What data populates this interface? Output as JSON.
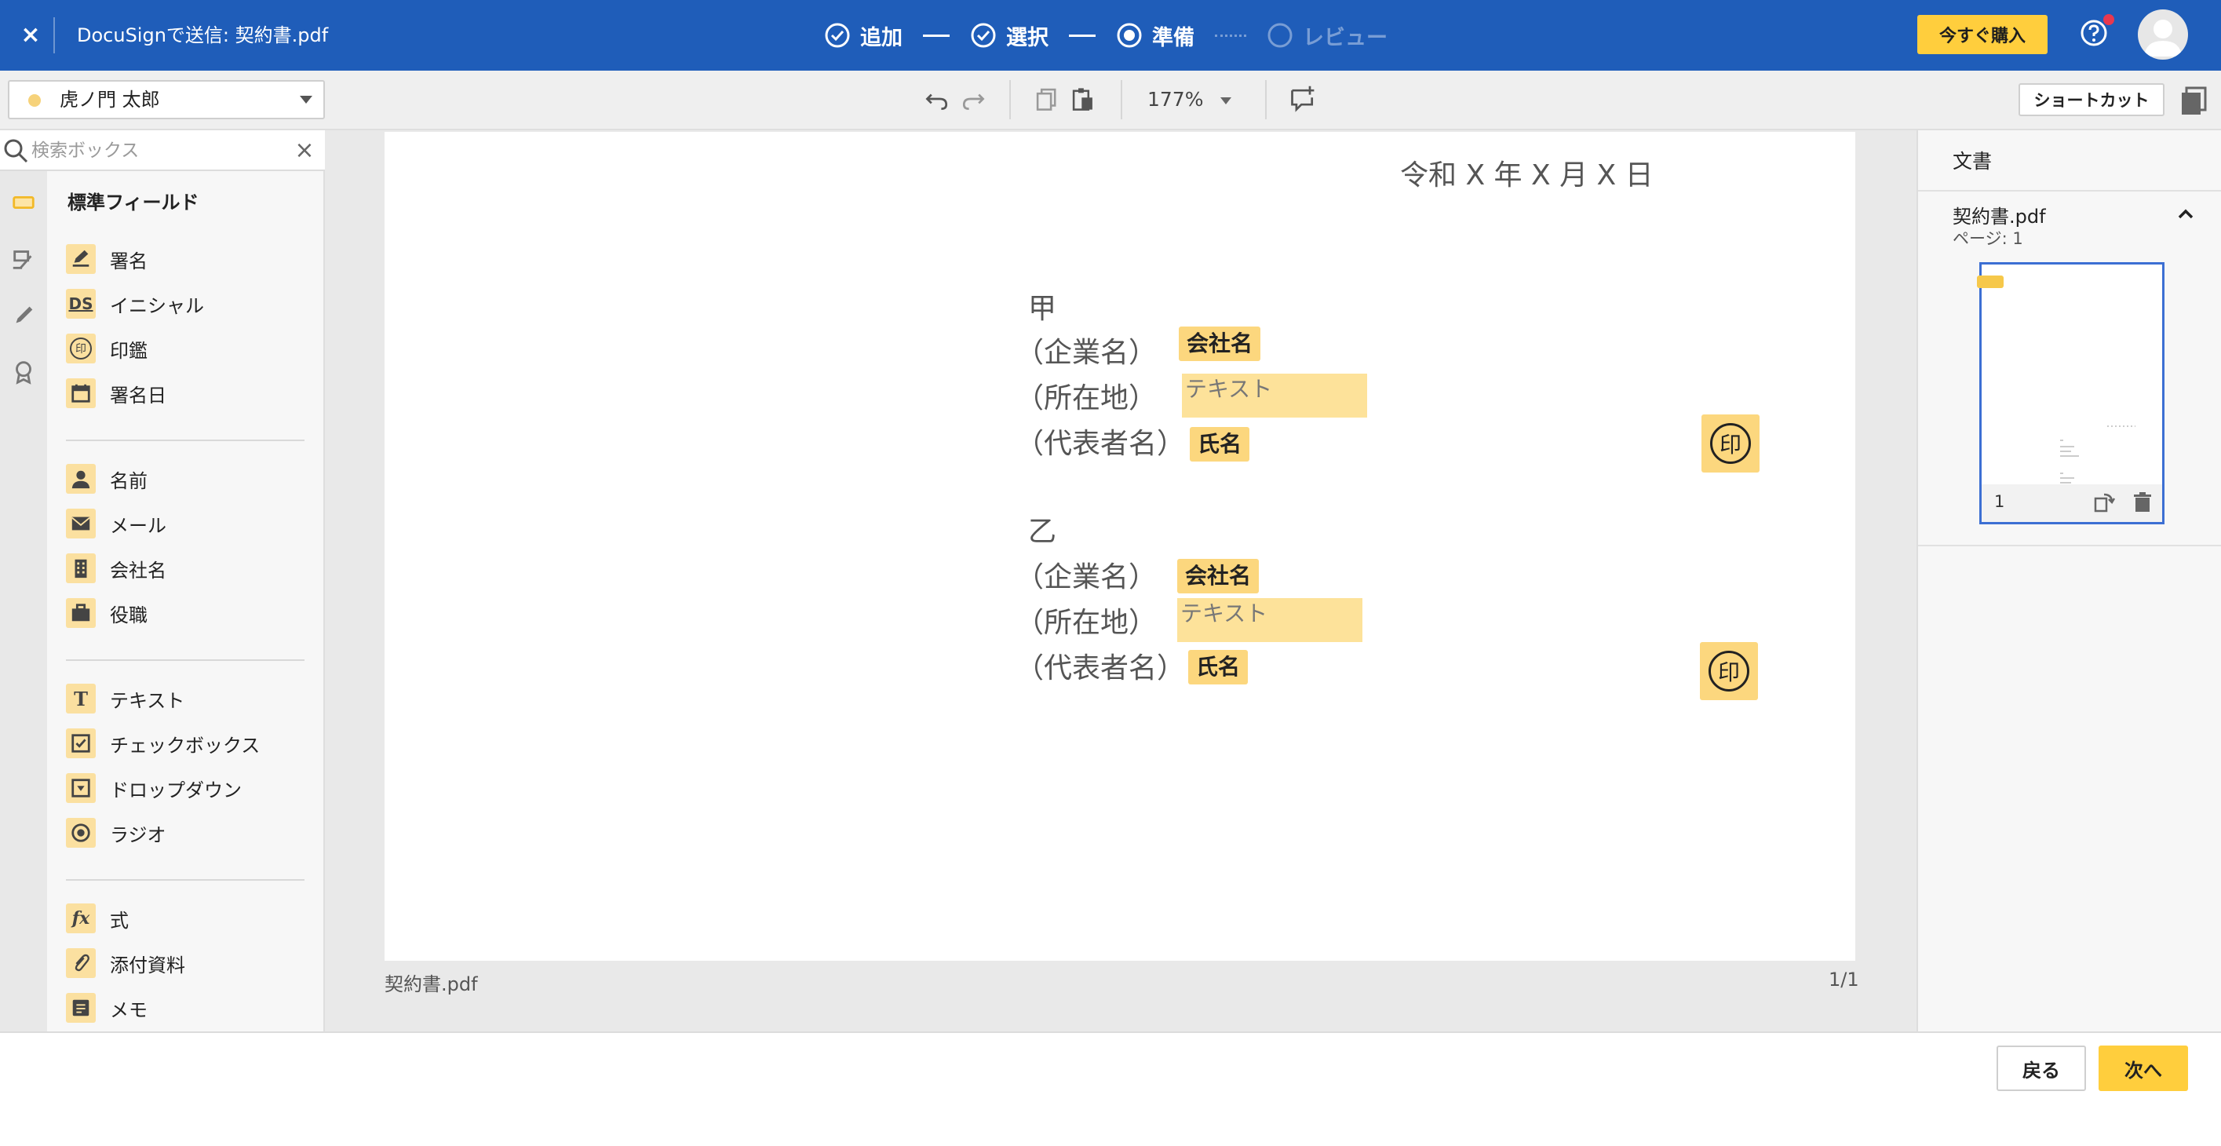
{
  "header": {
    "close_label": "×",
    "title": "DocuSignで送信: 契約書.pdf",
    "steps": [
      {
        "label": "追加",
        "state": "done"
      },
      {
        "label": "選択",
        "state": "done"
      },
      {
        "label": "準備",
        "state": "current"
      },
      {
        "label": "レビュー",
        "state": "pending"
      }
    ],
    "buy_label": "今すぐ購入"
  },
  "toolbar": {
    "recipient_name": "虎ノ門 太郎",
    "zoom": "177%",
    "shortcut_label": "ショートカット"
  },
  "search": {
    "placeholder": "検索ボックス",
    "clear_label": "×"
  },
  "fields_panel": {
    "title": "標準フィールド",
    "groups": [
      [
        {
          "label": "署名",
          "icon": "signature-icon"
        },
        {
          "label": "イニシャル",
          "icon": "initials-icon"
        },
        {
          "label": "印鑑",
          "icon": "seal-icon"
        },
        {
          "label": "署名日",
          "icon": "calendar-icon"
        }
      ],
      [
        {
          "label": "名前",
          "icon": "person-icon"
        },
        {
          "label": "メール",
          "icon": "envelope-icon"
        },
        {
          "label": "会社名",
          "icon": "building-icon"
        },
        {
          "label": "役職",
          "icon": "briefcase-icon"
        }
      ],
      [
        {
          "label": "テキスト",
          "icon": "text-icon"
        },
        {
          "label": "チェックボックス",
          "icon": "checkbox-icon"
        },
        {
          "label": "ドロップダウン",
          "icon": "dropdown-icon"
        },
        {
          "label": "ラジオ",
          "icon": "radio-icon"
        }
      ],
      [
        {
          "label": "式",
          "icon": "formula-icon"
        },
        {
          "label": "添付資料",
          "icon": "paperclip-icon"
        },
        {
          "label": "メモ",
          "icon": "note-icon"
        }
      ]
    ],
    "icon_glyphs": {
      "initials": "DS",
      "seal": "印",
      "text": "T",
      "formula": "fx"
    }
  },
  "document": {
    "date": "令和 X 年 X 月 X 日",
    "party_a": "甲",
    "party_b": "乙",
    "label_company": "（企業名）",
    "label_address": "（所在地）",
    "label_rep": "（代表者名）",
    "tag_company": "会社名",
    "tag_text": "テキスト",
    "tag_name": "氏名",
    "stamp_glyph": "印",
    "footer_name": "契約書.pdf",
    "footer_count": "1/1"
  },
  "right_panel": {
    "title": "文書",
    "file_name": "契約書.pdf",
    "pages": "ページ: 1",
    "thumb_page": "1"
  },
  "footer": {
    "back_label": "戻る",
    "next_label": "次へ"
  },
  "colors": {
    "header_blue": "#1f5db9",
    "accent_yellow": "#ffce3d",
    "field_tag": "#fcd77e"
  }
}
